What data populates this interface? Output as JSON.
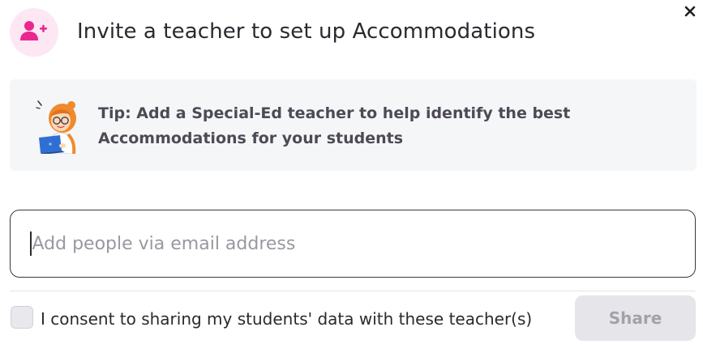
{
  "dialog": {
    "title": "Invite a teacher to set up Accommodations",
    "header_icon": "add-user-icon",
    "close_icon": "close-icon"
  },
  "tip": {
    "text_line1": "Tip: Add a Special-Ed teacher to help identify the best",
    "text_line2": "Accommodations for your students",
    "illustration": "teacher-with-laptop-illustration"
  },
  "email_input": {
    "placeholder": "Add people via email address",
    "value": ""
  },
  "consent": {
    "checked": false,
    "label": "I consent to sharing my students' data with these teacher(s)"
  },
  "actions": {
    "share_label": "Share",
    "share_enabled": false
  },
  "colors": {
    "accent_pink": "#e8288f",
    "avatar_bg": "#fce7f3",
    "tip_bg": "#f5f6f8",
    "disabled_button_bg": "#e5e5ea"
  }
}
